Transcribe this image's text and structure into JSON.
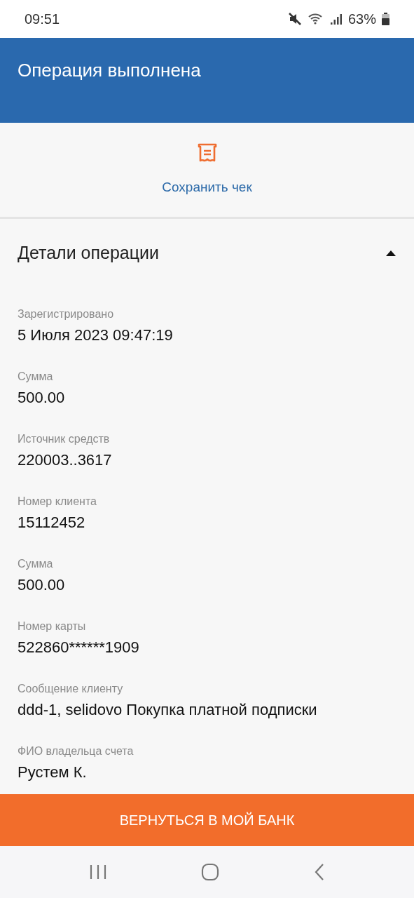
{
  "status_bar": {
    "time": "09:51",
    "battery": "63%"
  },
  "header": {
    "title": "Операция выполнена"
  },
  "save_receipt": {
    "label": "Сохранить чек"
  },
  "details": {
    "title": "Детали операции",
    "expanded": true,
    "fields": [
      {
        "label": "Зарегистрировано",
        "value": "5 Июля 2023 09:47:19"
      },
      {
        "label": "Сумма",
        "value": "500.00"
      },
      {
        "label": "Источник средств",
        "value": "220003..3617"
      },
      {
        "label": "Номер клиента",
        "value": "15112452"
      },
      {
        "label": "Сумма",
        "value": "500.00"
      },
      {
        "label": "Номер карты",
        "value": "522860******1909"
      },
      {
        "label": "Сообщение клиенту",
        "value": "ddd-1, selidovo Покупка платной подписки"
      },
      {
        "label": "ФИО владельца счета",
        "value": "Рустем К."
      }
    ]
  },
  "action_button": {
    "label": "ВЕРНУТЬСЯ В МОЙ БАНК"
  }
}
